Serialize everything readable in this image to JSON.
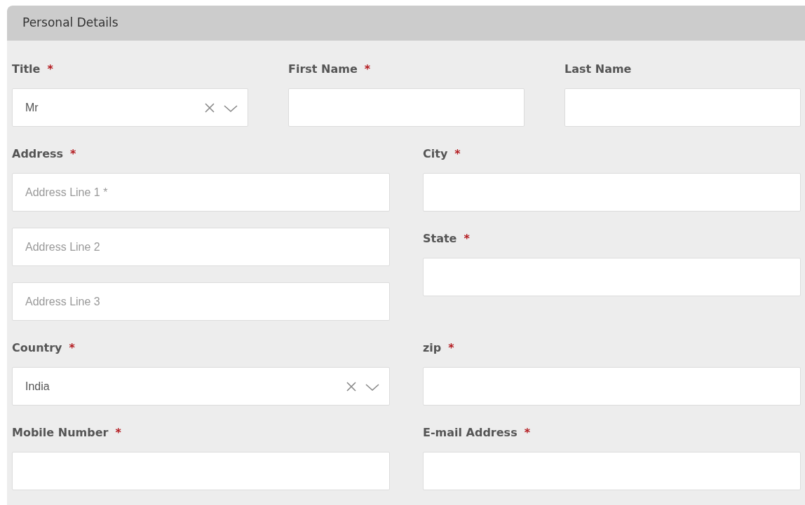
{
  "panel": {
    "title": "Personal Details"
  },
  "rows": [
    {
      "columns": [
        [
          {
            "kind": "label",
            "text": "Title",
            "required_mark": "*"
          },
          {
            "kind": "select",
            "value": "Mr"
          }
        ],
        [
          {
            "kind": "label",
            "text": "First Name",
            "required_mark": "*"
          },
          {
            "kind": "input"
          }
        ],
        [
          {
            "kind": "label",
            "text": "Last Name"
          },
          {
            "kind": "input"
          }
        ]
      ]
    },
    {
      "columns": [
        [
          {
            "kind": "label",
            "text": "Address",
            "required_mark": "*"
          },
          {
            "kind": "input",
            "placeholder": "Address Line 1 *"
          },
          {
            "kind": "input",
            "placeholder": "Address Line 2"
          },
          {
            "kind": "input",
            "placeholder": "Address Line 3"
          }
        ],
        [
          {
            "kind": "label",
            "text": "City",
            "required_mark": "*"
          },
          {
            "kind": "input"
          },
          {
            "kind": "label",
            "text": "State",
            "required_mark": "*"
          },
          {
            "kind": "input"
          }
        ]
      ]
    },
    {
      "columns": [
        [
          {
            "kind": "label",
            "text": "Country",
            "required_mark": "*"
          },
          {
            "kind": "select",
            "value": "India"
          }
        ],
        [
          {
            "kind": "label",
            "text": "zip",
            "required_mark": "*"
          },
          {
            "kind": "input"
          }
        ]
      ]
    },
    {
      "columns": [
        [
          {
            "kind": "label",
            "text": "Mobile Number",
            "required_mark": "*"
          },
          {
            "kind": "input"
          }
        ],
        [
          {
            "kind": "label",
            "text": "E-mail Address",
            "required_mark": "*"
          },
          {
            "kind": "input"
          }
        ]
      ]
    }
  ]
}
